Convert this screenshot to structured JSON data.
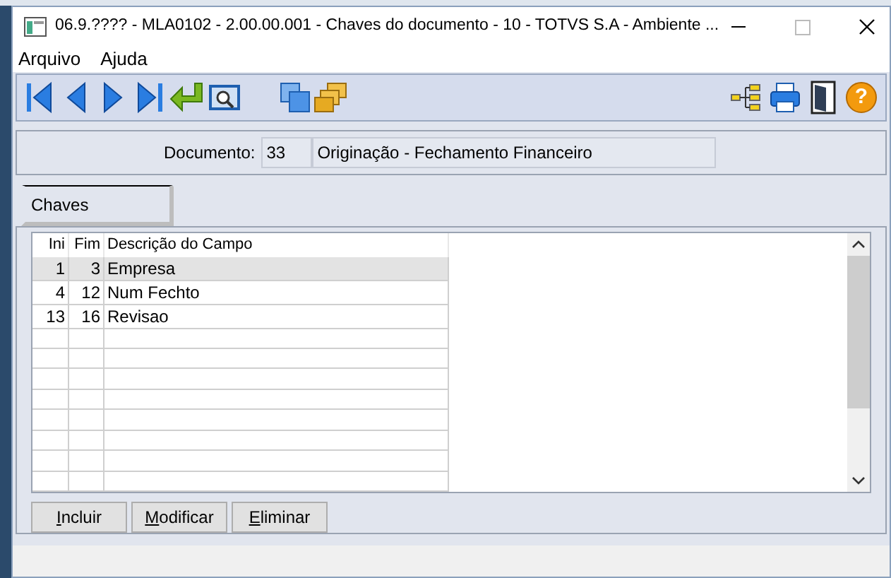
{
  "window": {
    "title": "06.9.???? - MLA0102 - 2.00.00.001 - Chaves do documento - 10 - TOTVS S.A - Ambiente ..."
  },
  "menu": [
    "Arquivo",
    "Ajuda"
  ],
  "toolbar": {
    "help_glyph": "?"
  },
  "documento": {
    "label": "Documento:",
    "code": "33",
    "description": "Originação - Fechamento Financeiro"
  },
  "tabs": [
    {
      "label": "Chaves",
      "selected": true
    }
  ],
  "table": {
    "columns": [
      "Ini",
      "Fim",
      "Descrição do Campo"
    ],
    "rows": [
      {
        "ini": "1",
        "fim": "3",
        "descricao": "Empresa",
        "selected": true
      },
      {
        "ini": "4",
        "fim": "12",
        "descricao": "Num Fechto",
        "selected": false
      },
      {
        "ini": "13",
        "fim": "16",
        "descricao": "Revisao",
        "selected": false
      }
    ]
  },
  "buttons": [
    "Incluir",
    "Modificar",
    "Eliminar"
  ]
}
